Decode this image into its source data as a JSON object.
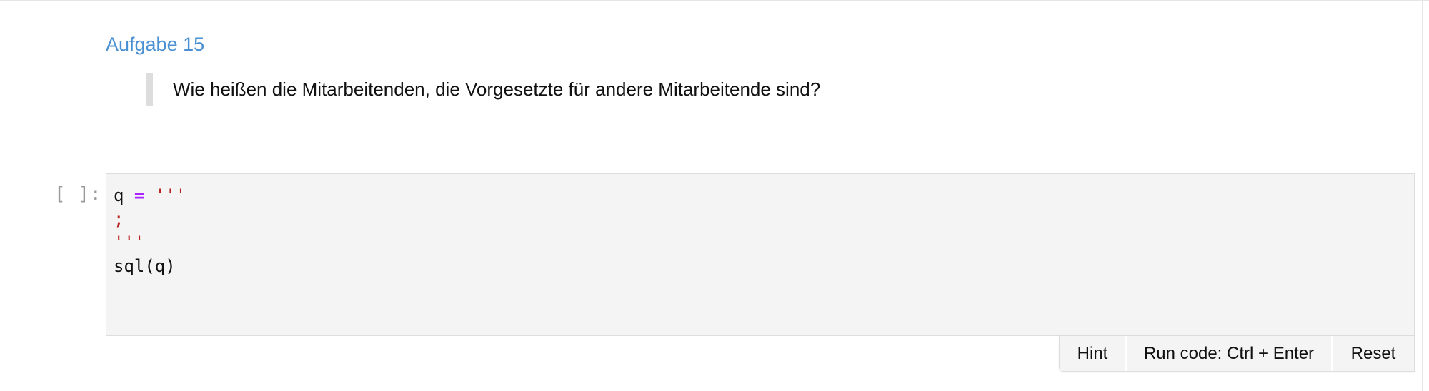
{
  "markdown": {
    "heading": "Aufgabe 15",
    "question": "Wie heißen die Mitarbeitenden, die Vorgesetzte für andere Mitarbeitende sind?"
  },
  "code_cell": {
    "prompt": "[ ]:",
    "lines": {
      "l1_var": "q",
      "l1_op": "=",
      "l1_str": "'''",
      "l2_str": ";",
      "l3_str": "'''",
      "l4": "sql(q)"
    }
  },
  "toolbar": {
    "hint_label": "Hint",
    "run_label": "Run code: Ctrl + Enter",
    "reset_label": "Reset"
  },
  "colors": {
    "heading": "#4a90d2",
    "operator": "#aa22ff",
    "string": "#ba2121",
    "editor_bg": "#f4f4f4"
  }
}
